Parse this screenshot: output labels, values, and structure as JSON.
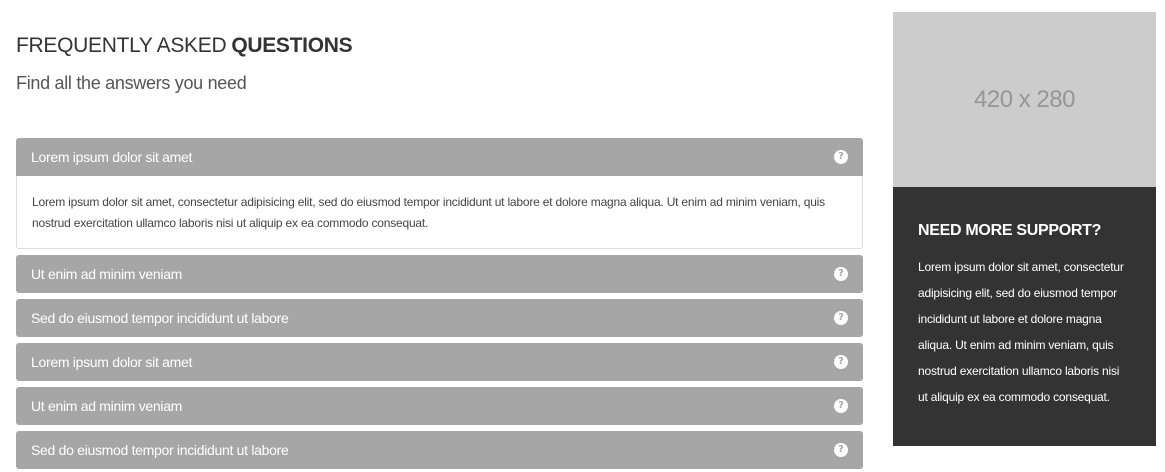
{
  "faq": {
    "title_light": "FREQUENTLY ASKED",
    "title_bold": "QUESTIONS",
    "subtitle": "Find all the answers you need",
    "items": [
      {
        "label": "Lorem ipsum dolor sit amet",
        "icon": "question-circle-icon",
        "expanded": true,
        "content": "Lorem ipsum dolor sit amet, consectetur adipisicing elit, sed do eiusmod tempor incididunt ut labore et dolore magna aliqua. Ut enim ad minim veniam, quis nostrud exercitation ullamco laboris nisi ut aliquip ex ea commodo consequat."
      },
      {
        "label": "Ut enim ad minim veniam",
        "icon": "question-circle-icon",
        "expanded": false
      },
      {
        "label": "Sed do eiusmod tempor incididunt ut labore",
        "icon": "question-circle-icon",
        "expanded": false
      },
      {
        "label": "Lorem ipsum dolor sit amet",
        "icon": "question-circle-icon",
        "expanded": false
      },
      {
        "label": "Ut enim ad minim veniam",
        "icon": "question-circle-icon",
        "expanded": false
      },
      {
        "label": "Sed do eiusmod tempor incididunt ut labore",
        "icon": "question-circle-icon",
        "expanded": false
      }
    ]
  },
  "sidebar": {
    "image_placeholder": "420 x 280",
    "support": {
      "title": "NEED MORE SUPPORT?",
      "text": "Lorem ipsum dolor sit amet, consectetur adipisicing elit, sed do eiusmod tempor incididunt ut labore et dolore magna aliqua. Ut enim ad minim veniam, quis nostrud exercitation ullamco laboris nisi ut aliquip ex ea commodo consequat."
    }
  },
  "colors": {
    "accordion_header": "#a6a6a6",
    "support_bg": "#333333",
    "placeholder_bg": "#cccccc"
  }
}
